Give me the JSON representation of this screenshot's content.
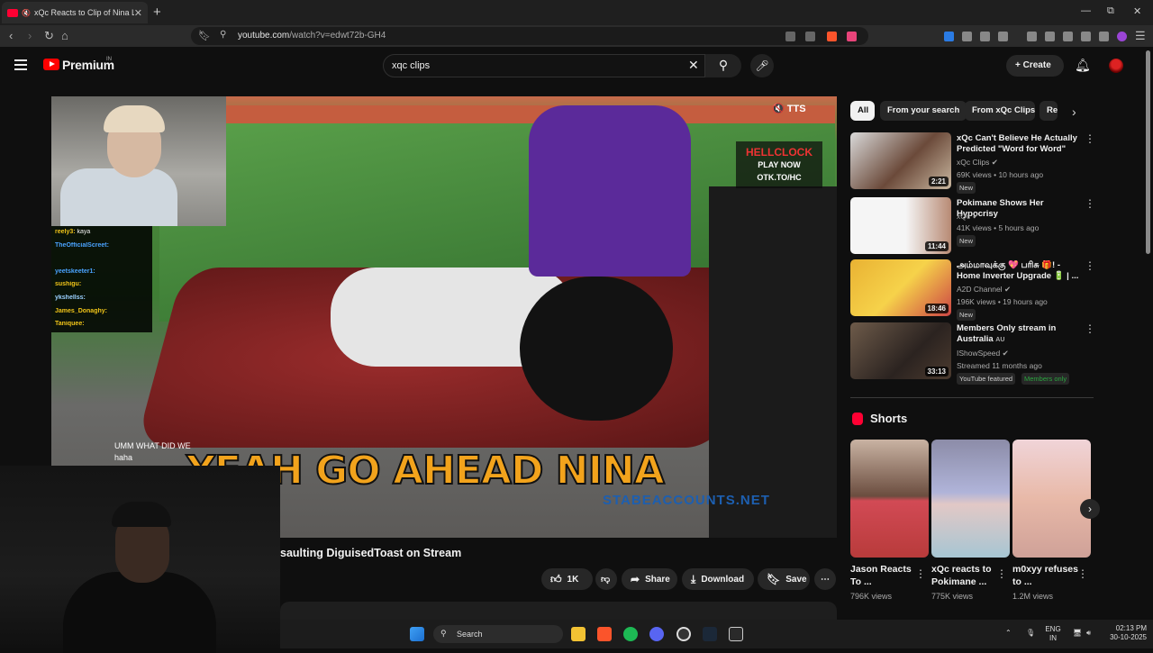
{
  "browser": {
    "tab_title": "xQc Reacts to Clip of Nina Li...",
    "tab_mute_icon": "speaker-muted-icon",
    "url_host": "youtube.com",
    "url_path": "/watch?v=edwt72b-GH4"
  },
  "youtube": {
    "logo_text": "Premium",
    "country_code": "IN",
    "search_value": "xqc clips",
    "create_label": "Create"
  },
  "player": {
    "tts_label": "TTS",
    "sponsor_line1": "HELLCLOCK",
    "sponsor_line2": "PLAY NOW",
    "sponsor_line3": "OTK.TO/HC",
    "caption": "YEAH GO AHEAD NINA",
    "watermark": "STABEACCOUNTS.NET",
    "chat": [
      {
        "user": "reely3:",
        "msg": "kaya",
        "cls": "u2"
      },
      {
        "user": "TheOfficialScreet:",
        "msg": "",
        "cls": "u"
      },
      {
        "user": "",
        "msg": "",
        "cls": "u"
      },
      {
        "user": "yeetskeeter1:",
        "msg": "",
        "cls": "u"
      },
      {
        "user": "sushigu:",
        "msg": "",
        "cls": "u2"
      },
      {
        "user": "ykshellss:",
        "msg": "",
        "cls": "u3"
      },
      {
        "user": "James_Donaghy:",
        "msg": "",
        "cls": "u2"
      },
      {
        "user": "Taniquee:",
        "msg": "",
        "cls": "u2"
      }
    ],
    "low_chat": [
      {
        "msg": "UMM WHAT DID WE"
      },
      {
        "msg": "haha"
      }
    ]
  },
  "video": {
    "title_visible": "saulting DiguisedToast on Stream",
    "like_count": "1K",
    "share_label": "Share",
    "download_label": "Download",
    "save_label": "Save"
  },
  "chips": [
    "All",
    "From your search",
    "From xQc Clips",
    "Re"
  ],
  "recommendations": [
    {
      "title": "xQc Can't Believe He Actually Predicted \"Word for Word\" Wh...",
      "channel": "xQc Clips",
      "meta": "69K views • 10 hours ago",
      "badge": "New",
      "duration": "2:21",
      "thumb": "linear-gradient(135deg,#d9d9d9,#6b4a3a 55%,#c9b7a0)"
    },
    {
      "title": "Pokimane Shows Her Hypocrisy",
      "channel": "xQc",
      "meta": "41K views • 5 hours ago",
      "badge": "New",
      "duration": "11:44",
      "thumb": "linear-gradient(90deg,#f5f5f5 55%,#b88a74)"
    },
    {
      "title": "அம்மாவுக்கு 💖 பரிசு 🎁! - Home Inverter Upgrade 🔋 | ...",
      "channel": "A2D Channel",
      "meta": "196K views • 19 hours ago",
      "badge": "New",
      "duration": "18:46",
      "thumb": "linear-gradient(135deg,#e9b233,#f6d24a 50%,#c44)"
    },
    {
      "title": "Members Only stream in Australia",
      "channel": "IShowSpeed",
      "meta": "Streamed 11 months ago",
      "badge": "YouTube featured",
      "badge2": "Members only",
      "duration": "33:13",
      "thumb": "linear-gradient(135deg,#6e5b4a,#2b2320 60%,#4c3b2f)"
    }
  ],
  "shorts": {
    "heading": "Shorts",
    "items": [
      {
        "title": "Jason Reacts To ...",
        "views": "796K views",
        "thumb": "linear-gradient(180deg,#c9b3a3,#6b4d3f 48%,#d24a55 52%,#b83b3b)"
      },
      {
        "title": "xQc reacts to Pokimane ...",
        "views": "775K views",
        "thumb": "linear-gradient(180deg,#8c8ca8,#b0b4d9 45%,#e2c8c6 55%,#a7c6d3)"
      },
      {
        "title": "m0xyy refuses to ...",
        "views": "1.2M views",
        "thumb": "linear-gradient(180deg,#f0d4d8,#e8b9a8 50%,#cfa198)"
      }
    ]
  },
  "taskbar": {
    "search_label": "Search",
    "lang_line1": "ENG",
    "lang_line2": "IN",
    "time": "02:13 PM",
    "date": "30-10-2025"
  }
}
